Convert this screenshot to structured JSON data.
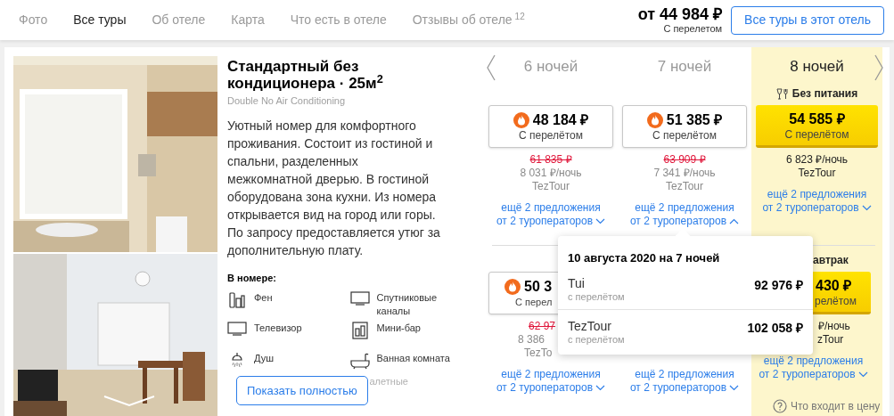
{
  "nav": {
    "tabs": [
      {
        "label": "Фото",
        "selected": false
      },
      {
        "label": "Все туры",
        "selected": true
      },
      {
        "label": "Об отеле",
        "selected": false
      },
      {
        "label": "Карта",
        "selected": false
      },
      {
        "label": "Что есть в отеле",
        "selected": false
      },
      {
        "label": "Отзывы об отеле",
        "count": "12",
        "selected": false
      }
    ],
    "price": "от 44 984 ₽",
    "price_note": "С перелетом",
    "button": "Все туры в этот отель"
  },
  "room": {
    "title": "Стандартный без кондиционера · 25м$^{2}$",
    "subtitle": "Double No Air Conditioning",
    "description": "Уютный номер для комфортного проживания. Состоит из гостиной и спальни, разделенных межкомнатной дверью. В гостиной оборудована зона кухни. Из номера открывается вид на город или горы. По запросу предоставляется утюг за дополнительную плату.",
    "amenities_title": "В номере:",
    "amenities": [
      {
        "kind": "toiletries",
        "label": "Фен"
      },
      {
        "kind": "tv",
        "label": "Спутниковые каналы"
      },
      {
        "kind": "tv",
        "label": "Телевизор"
      },
      {
        "kind": "minibar",
        "label": "Мини-бар"
      },
      {
        "kind": "shower",
        "label": "Душ"
      },
      {
        "kind": "bath",
        "label": "Ванная комната"
      }
    ],
    "faded_amenity": "алетные",
    "show_more": "Показать полностью"
  },
  "prices": {
    "nights": [
      {
        "label": "6 ночей",
        "selected": false
      },
      {
        "label": "7 ночей",
        "selected": false
      },
      {
        "label": "8 ночей",
        "selected": true
      }
    ],
    "rows": [
      {
        "meal": "Без питания",
        "cells": [
          {
            "hot": true,
            "price": "48 184 ₽",
            "note": "С перелётом",
            "old_price": "61 835 ₽",
            "per_night": "8 031 ₽/ночь",
            "operator": "TezTour",
            "more": "ещё 2 предложения",
            "more2": "от 2 туроператоров",
            "expanded": false
          },
          {
            "hot": true,
            "price": "51 385 ₽",
            "note": "С перелётом",
            "old_price": "63 909 ₽",
            "per_night": "7 341 ₽/ночь",
            "operator": "TezTour",
            "more": "ещё 2 предложения",
            "more2": "от 2 туроператоров",
            "expanded": true
          },
          {
            "hot": false,
            "price": "54 585 ₽",
            "note": "С перелётом",
            "per_night": "6 823 ₽/ночь",
            "operator": "TezTour",
            "more": "ещё 2 предложения",
            "more2": "от 2 туроператоров",
            "expanded": false
          }
        ]
      },
      {
        "meal": "автрак",
        "clipped_left": true,
        "cells": [
          {
            "clipped_right": true,
            "hot": true,
            "price": "50 3",
            "note": "С перел",
            "old_price": "62 97",
            "per_night": "8 386",
            "operator": "TezTo",
            "more": "ещё 2 предложения",
            "more2": "от 2 туроператоров",
            "expanded": false
          },
          {
            "more": "ещё 2 предложения",
            "more2": "от 2 туроператоров",
            "expanded": false
          },
          {
            "clipped_left": true,
            "hot": false,
            "price": "430 ₽",
            "note": "релётом",
            "per_night": "₽/ночь",
            "operator": "zTour",
            "more": "ещё 2 предложения",
            "more2": "от 2 туроператоров",
            "expanded": false
          }
        ]
      }
    ],
    "help": "Что входит в цену"
  },
  "popover": {
    "title": "10 августа 2020 на 7 ночей",
    "offers": [
      {
        "operator": "Tui",
        "note": "с перелётом",
        "price": "92 976 ₽"
      },
      {
        "operator": "TezTour",
        "note": "с перелётом",
        "price": "102 058 ₽"
      }
    ]
  }
}
